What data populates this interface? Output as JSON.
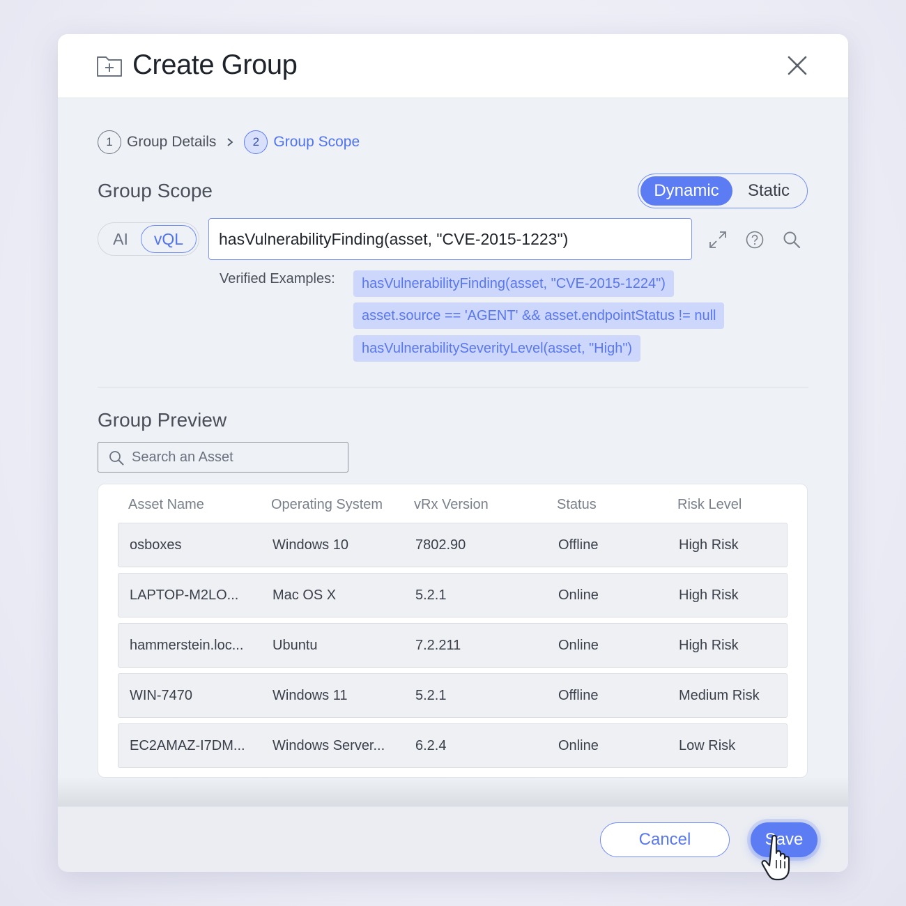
{
  "dialog": {
    "title": "Create Group",
    "icons": {
      "title": "folder-plus-icon",
      "close": "close-icon"
    }
  },
  "stepper": {
    "steps": [
      {
        "number": "1",
        "label": "Group Details",
        "active": false
      },
      {
        "number": "2",
        "label": "Group Scope",
        "active": true
      }
    ],
    "separator_icon": "chevron-right-icon"
  },
  "scope": {
    "title": "Group Scope",
    "mode_options": [
      "Dynamic",
      "Static"
    ],
    "selected_mode": "Dynamic",
    "language_options": [
      "AI",
      "vQL"
    ],
    "selected_language": "vQL",
    "query_value": "hasVulnerabilityFinding(asset, \"CVE-2015-1223\")",
    "tool_icons": [
      "expand-icon",
      "help-icon",
      "search-icon"
    ],
    "examples_label": "Verified Examples:",
    "examples": [
      "hasVulnerabilityFinding(asset, \"CVE-2015-1224\")",
      "asset.source == 'AGENT' && asset.endpointStatus != null",
      "hasVulnerabilitySeverityLevel(asset, \"High\")"
    ]
  },
  "preview": {
    "title": "Group Preview",
    "search_placeholder": "Search an Asset",
    "columns": [
      "Asset Name",
      "Operating System",
      "vRx Version",
      "Status",
      "Risk Level"
    ],
    "rows": [
      [
        "osboxes",
        "Windows 10",
        "7802.90",
        "Offline",
        "High Risk"
      ],
      [
        "LAPTOP-M2LO...",
        "Mac OS X",
        "5.2.1",
        "Online",
        "High Risk"
      ],
      [
        "hammerstein.loc...",
        "Ubuntu",
        "7.2.211",
        "Online",
        "High Risk"
      ],
      [
        "WIN-7470",
        "Windows 11",
        "5.2.1",
        "Offline",
        "Medium Risk"
      ],
      [
        "EC2AMAZ-I7DM...",
        "Windows Server...",
        "6.2.4",
        "Online",
        "Low Risk"
      ]
    ]
  },
  "footer": {
    "cancel_label": "Cancel",
    "save_label": "Save"
  },
  "colors": {
    "accent": "#5b7cf2",
    "chip_bg": "#cdd6fb",
    "dialog_bg": "#eef1f5"
  }
}
